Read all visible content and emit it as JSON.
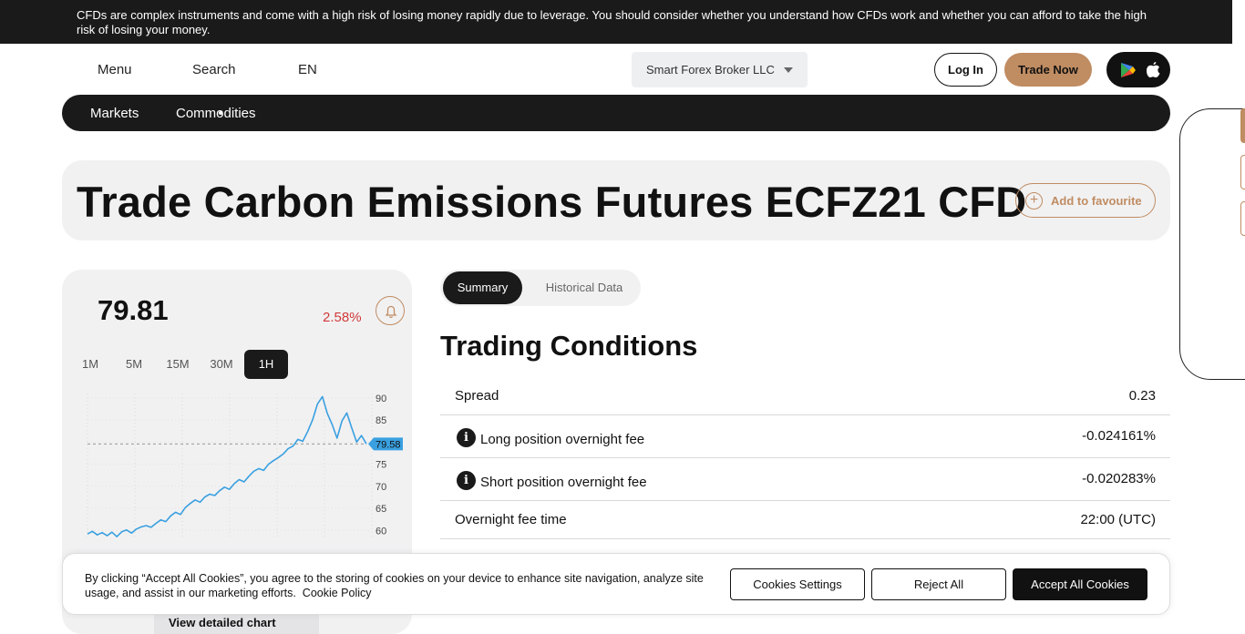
{
  "risk_banner": {
    "text": "CFDs are complex instruments and come with a high risk of losing money rapidly due to leverage. You should consider whether you understand how CFDs work and whether you can afford to take the high risk of losing your money."
  },
  "nav": {
    "menu": "Menu",
    "search": "Search",
    "language": "EN",
    "broker_select": "Smart Forex Broker LLC",
    "login": "Log In",
    "trade_now": "Trade Now"
  },
  "breadcrumb": {
    "items": [
      "Markets",
      "Commodities"
    ]
  },
  "page": {
    "title": "Trade Carbon Emissions Futures ECFZ21 CFD",
    "favourite": "Add to favourite"
  },
  "quote": {
    "price": "79.81",
    "change": "2.58%",
    "timeframes": [
      "1M",
      "5M",
      "15M",
      "30M",
      "1H"
    ],
    "active_timeframe": "1H",
    "view_chart": "View detailed chart"
  },
  "chart_data": {
    "type": "line",
    "current_label": "79.58",
    "current_value": 79.58,
    "y_ticks": [
      "90",
      "85",
      "80",
      "75",
      "70",
      "65",
      "60"
    ],
    "ylim": [
      58,
      91
    ],
    "values": [
      59.2,
      59.8,
      59.0,
      59.5,
      58.8,
      59.6,
      58.6,
      59.7,
      60.1,
      59.4,
      60.3,
      60.8,
      61.1,
      60.7,
      61.6,
      62.4,
      62.0,
      63.3,
      64.1,
      63.6,
      65.2,
      66.1,
      66.9,
      66.4,
      67.6,
      68.2,
      67.9,
      69.0,
      69.8,
      69.3,
      70.6,
      71.5,
      71.0,
      72.3,
      73.4,
      74.0,
      73.6,
      75.0,
      75.8,
      76.5,
      77.3,
      78.5,
      79.1,
      80.6,
      80.2,
      82.4,
      85.0,
      88.6,
      90.3,
      86.5,
      84.0,
      80.9,
      84.8,
      86.6,
      83.2,
      80.0,
      81.5,
      79.6
    ]
  },
  "tabs": {
    "summary": "Summary",
    "historical": "Historical Data"
  },
  "trading_conditions": {
    "title": "Trading Conditions",
    "rows": [
      {
        "label": "Spread",
        "value": "0.23"
      },
      {
        "label": "Long position overnight fee",
        "value": "-0.024161%"
      },
      {
        "label": "Short position overnight fee",
        "value": "-0.020283%"
      },
      {
        "label": "Overnight fee time",
        "value": "22:00 (UTC)"
      }
    ]
  },
  "cookie": {
    "text": "By clicking “Accept All Cookies”, you agree to the storing of cookies on your device to enhance site navigation, analyze site usage, and assist in our marketing efforts.",
    "policy_link": "Cookie Policy",
    "settings": "Cookies Settings",
    "reject": "Reject All",
    "accept": "Accept All Cookies"
  },
  "colors": {
    "accent": "#c08c62",
    "dark": "#1a1a1a",
    "negative": "#d23a3a",
    "chart_line": "#3aa0e0"
  }
}
